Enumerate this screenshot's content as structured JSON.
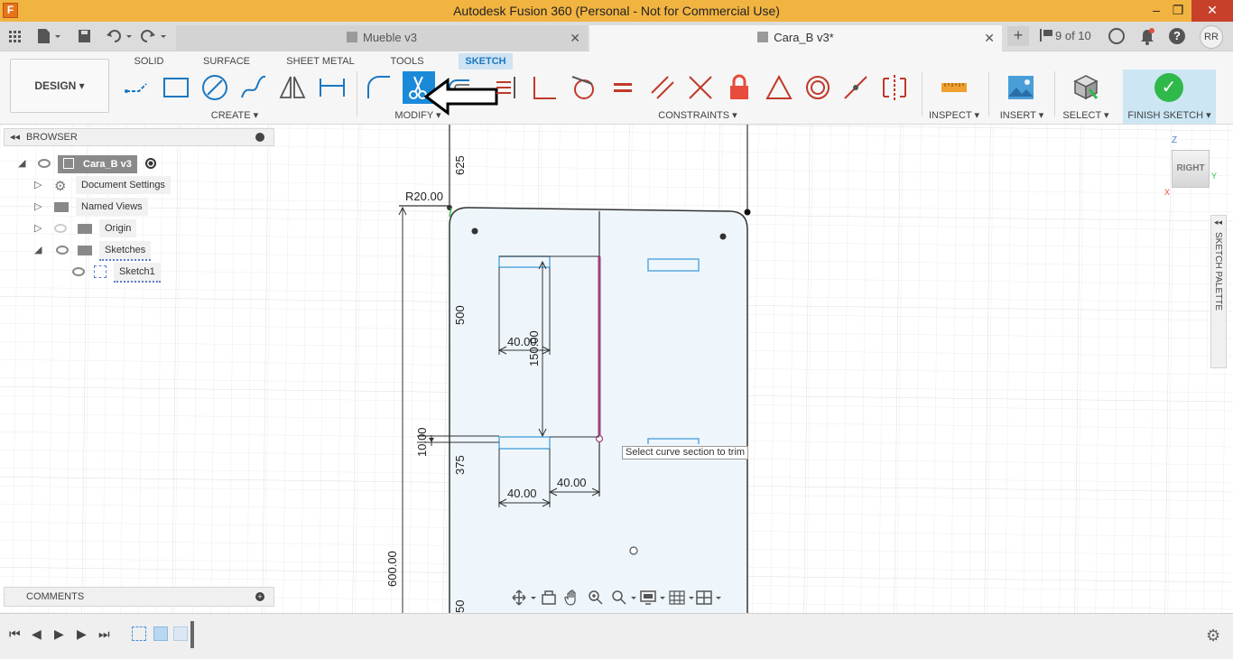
{
  "window": {
    "title": "Autodesk Fusion 360 (Personal - Not for Commercial Use)",
    "app_logo_letter": "F",
    "minimize": "–",
    "maximize": "❐",
    "close": "✕"
  },
  "tabs": {
    "inactive": {
      "label": "Mueble v3",
      "close": "✕"
    },
    "active": {
      "label": "Cara_B v3*",
      "close": "✕"
    },
    "new_tab": "+",
    "version_counter": "9 of 10",
    "user_initials": "RR"
  },
  "ribbon": {
    "workspace": "DESIGN ▾",
    "tabs": [
      "SOLID",
      "SURFACE",
      "SHEET METAL",
      "TOOLS",
      "SKETCH"
    ],
    "groups": {
      "create": "CREATE ▾",
      "modify": "MODIFY ▾",
      "constraints": "CONSTRAINTS ▾",
      "inspect": "INSPECT ▾",
      "insert": "INSERT ▾",
      "select": "SELECT ▾",
      "finish": "FINISH SKETCH ▾"
    },
    "finish_check": "✓",
    "accent_color": "#1a8ad8",
    "finish_color": "#2fb94a"
  },
  "browser": {
    "header": "BROWSER",
    "collapse": "◂◂",
    "items": [
      {
        "label": "Cara_B v3"
      },
      {
        "label": "Document Settings"
      },
      {
        "label": "Named Views"
      },
      {
        "label": "Origin"
      },
      {
        "label": "Sketches"
      },
      {
        "label": "Sketch1"
      }
    ]
  },
  "comments": {
    "header": "COMMENTS",
    "plus": "+"
  },
  "sketch_palette": {
    "label": "SKETCH PALETTE",
    "collapse": "◂◂"
  },
  "viewcube": {
    "face": "RIGHT",
    "z": "Z",
    "y": "Y",
    "x": "X"
  },
  "tooltip": "Select curve section to trim",
  "dimensions": {
    "d625": "625",
    "r20": "R20.00",
    "d500": "500",
    "d40a": "40.00",
    "d150": "150.00",
    "d10": "10.00",
    "d375": "375",
    "d40b": "40.00",
    "d40c": "40.00",
    "d600": "600.00",
    "d50": "50"
  },
  "timeline": {
    "first": "⏮",
    "prev": "◀",
    "play": "▶",
    "next": "▶",
    "last": "⏭",
    "settings": "⚙"
  }
}
